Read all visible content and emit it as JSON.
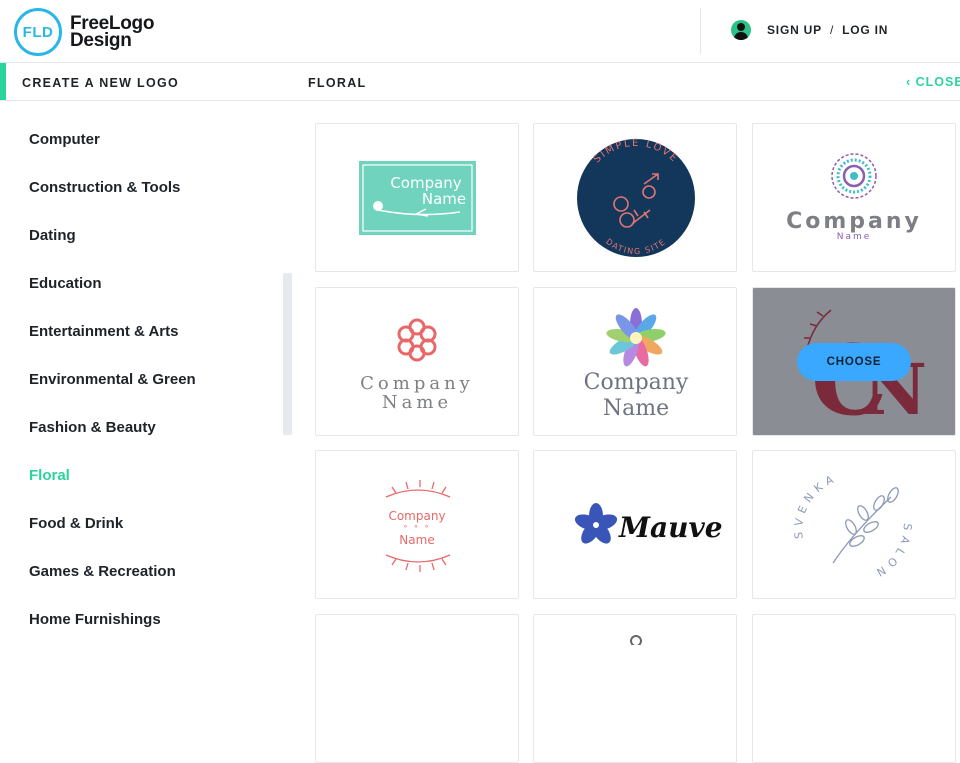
{
  "brand": {
    "initials": "FLD",
    "name_line1": "FreeLogo",
    "name_line2": "Design"
  },
  "auth": {
    "signup": "SIGN UP",
    "separator": "/",
    "login": "LOG IN"
  },
  "subheader": {
    "title": "CREATE A NEW LOGO",
    "category": "FLORAL",
    "close": "CLOSE"
  },
  "categories": [
    "Computer",
    "Construction & Tools",
    "Dating",
    "Education",
    "Entertainment & Arts",
    "Environmental & Green",
    "Fashion & Beauty",
    "Floral",
    "Food & Drink",
    "Games & Recreation",
    "Home Furnishings"
  ],
  "active_category": "Floral",
  "logos": {
    "card1": {
      "line1": "Company",
      "line2": "Name"
    },
    "card2": {
      "arc_top": "SIMPLE LOVE",
      "arc_bottom": "DATING SITE"
    },
    "card3": {
      "line1": "Company",
      "line2": "Name"
    },
    "card4": {
      "line1": "Company",
      "line2": "Name"
    },
    "card5": {
      "line1": "Company",
      "line2": "Name"
    },
    "card6": {
      "choose": "CHOOSE"
    },
    "card7": {
      "line1": "Company",
      "dots": "° ° °",
      "line2": "Name"
    },
    "card8": {
      "word": "Mauve"
    },
    "card9": {
      "arc_top": "SVENKA",
      "arc_right": "SALON"
    }
  },
  "colors": {
    "accent": "#2bd49b",
    "brand_blue": "#2bb6e8",
    "choose": "#3aa8ff"
  }
}
